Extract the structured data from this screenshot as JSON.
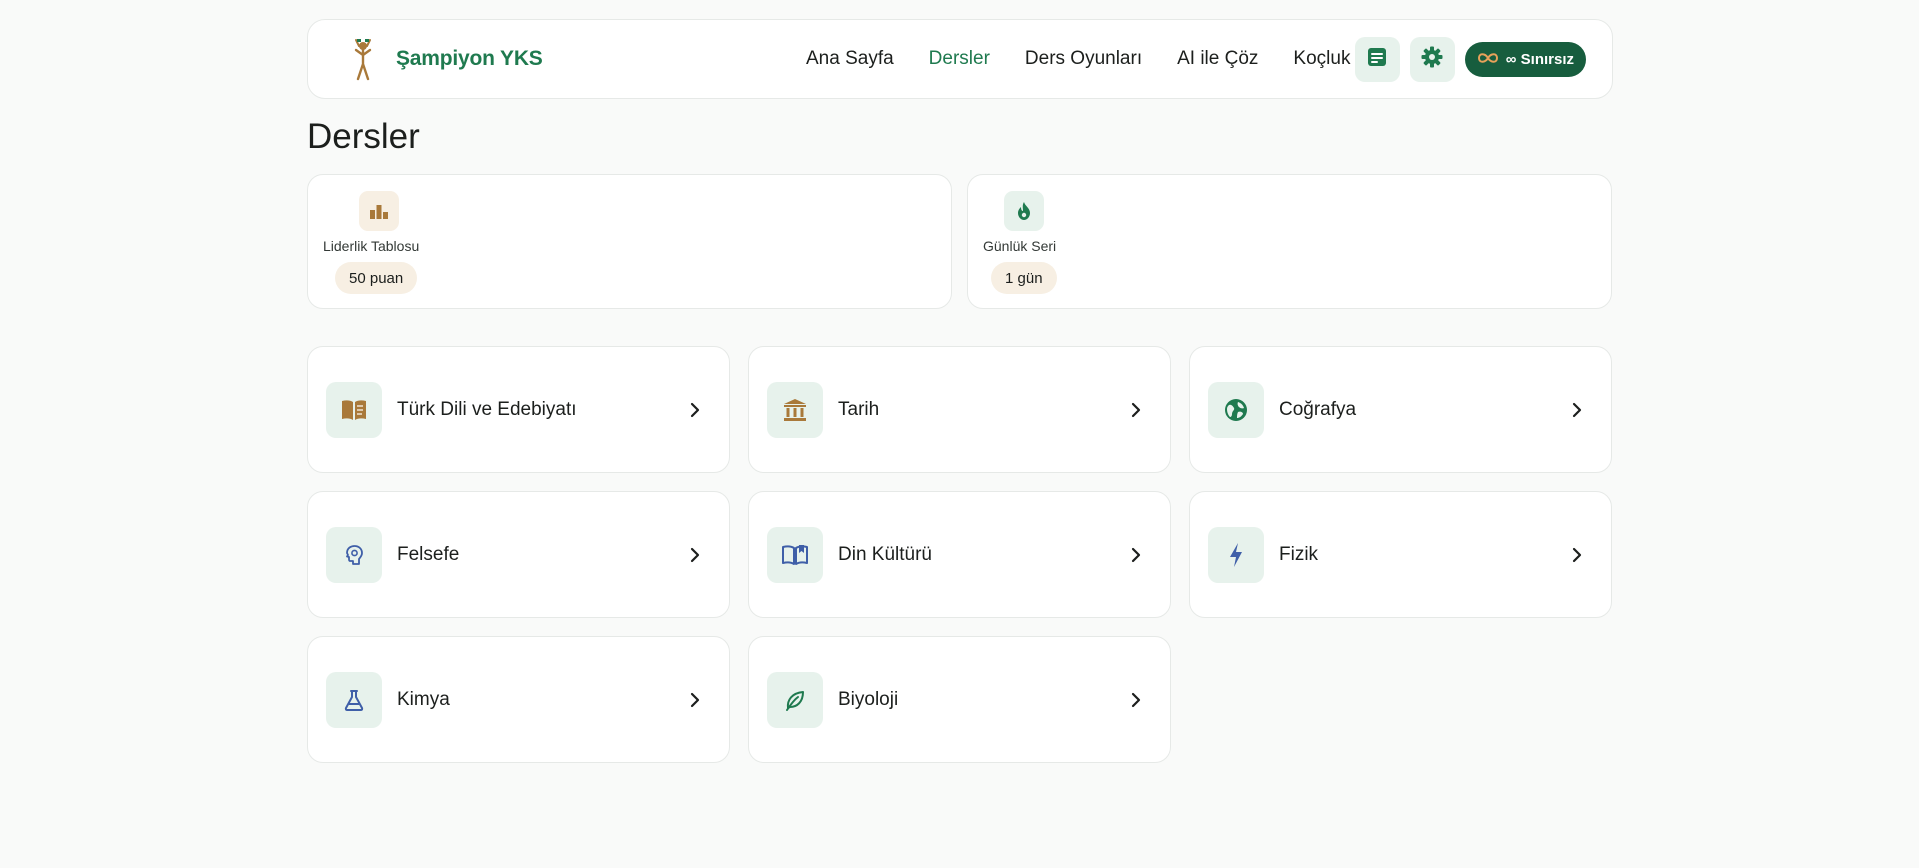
{
  "header": {
    "brand_name": "Şampiyon YKS",
    "nav": [
      {
        "label": "Ana Sayfa",
        "active": false
      },
      {
        "label": "Dersler",
        "active": true
      },
      {
        "label": "Ders Oyunları",
        "active": false
      },
      {
        "label": "AI ile Çöz",
        "active": false
      },
      {
        "label": "Koçluk",
        "active": false
      }
    ],
    "actions": {
      "notes_icon": "notes-icon",
      "settings_icon": "gear-icon",
      "plan_label": "∞ Sınırsız",
      "plan_icon": "infinity-icon"
    }
  },
  "page": {
    "title": "Dersler"
  },
  "stats": {
    "leaderboard": {
      "label": "Liderlik Tablosu",
      "value": "50 puan",
      "icon": "leaderboard-icon"
    },
    "streak": {
      "label": "Günlük Seri",
      "value": "1 gün",
      "icon": "flame-icon"
    }
  },
  "courses": [
    {
      "name": "Türk Dili ve Edebiyatı",
      "icon": "book-icon",
      "icon_color": "#a9793a"
    },
    {
      "name": "Tarih",
      "icon": "museum-icon",
      "icon_color": "#a9793a"
    },
    {
      "name": "Coğrafya",
      "icon": "globe-icon",
      "icon_color": "#1f7a4f"
    },
    {
      "name": "Felsefe",
      "icon": "brain-icon",
      "icon_color": "#3f5fa8"
    },
    {
      "name": "Din Kültürü",
      "icon": "open-book-icon",
      "icon_color": "#3f5fa8"
    },
    {
      "name": "Fizik",
      "icon": "bolt-icon",
      "icon_color": "#3f5fa8"
    },
    {
      "name": "Kimya",
      "icon": "flask-icon",
      "icon_color": "#3f5fa8"
    },
    {
      "name": "Biyoloji",
      "icon": "leaf-icon",
      "icon_color": "#1f7a4f"
    }
  ],
  "colors": {
    "brand_green": "#1f7a4f",
    "dark_green": "#175d3e",
    "gold": "#a9793a",
    "blue": "#3f5fa8",
    "icon_bg": "#e7f2ec",
    "pill_bg": "#f7efe3"
  }
}
